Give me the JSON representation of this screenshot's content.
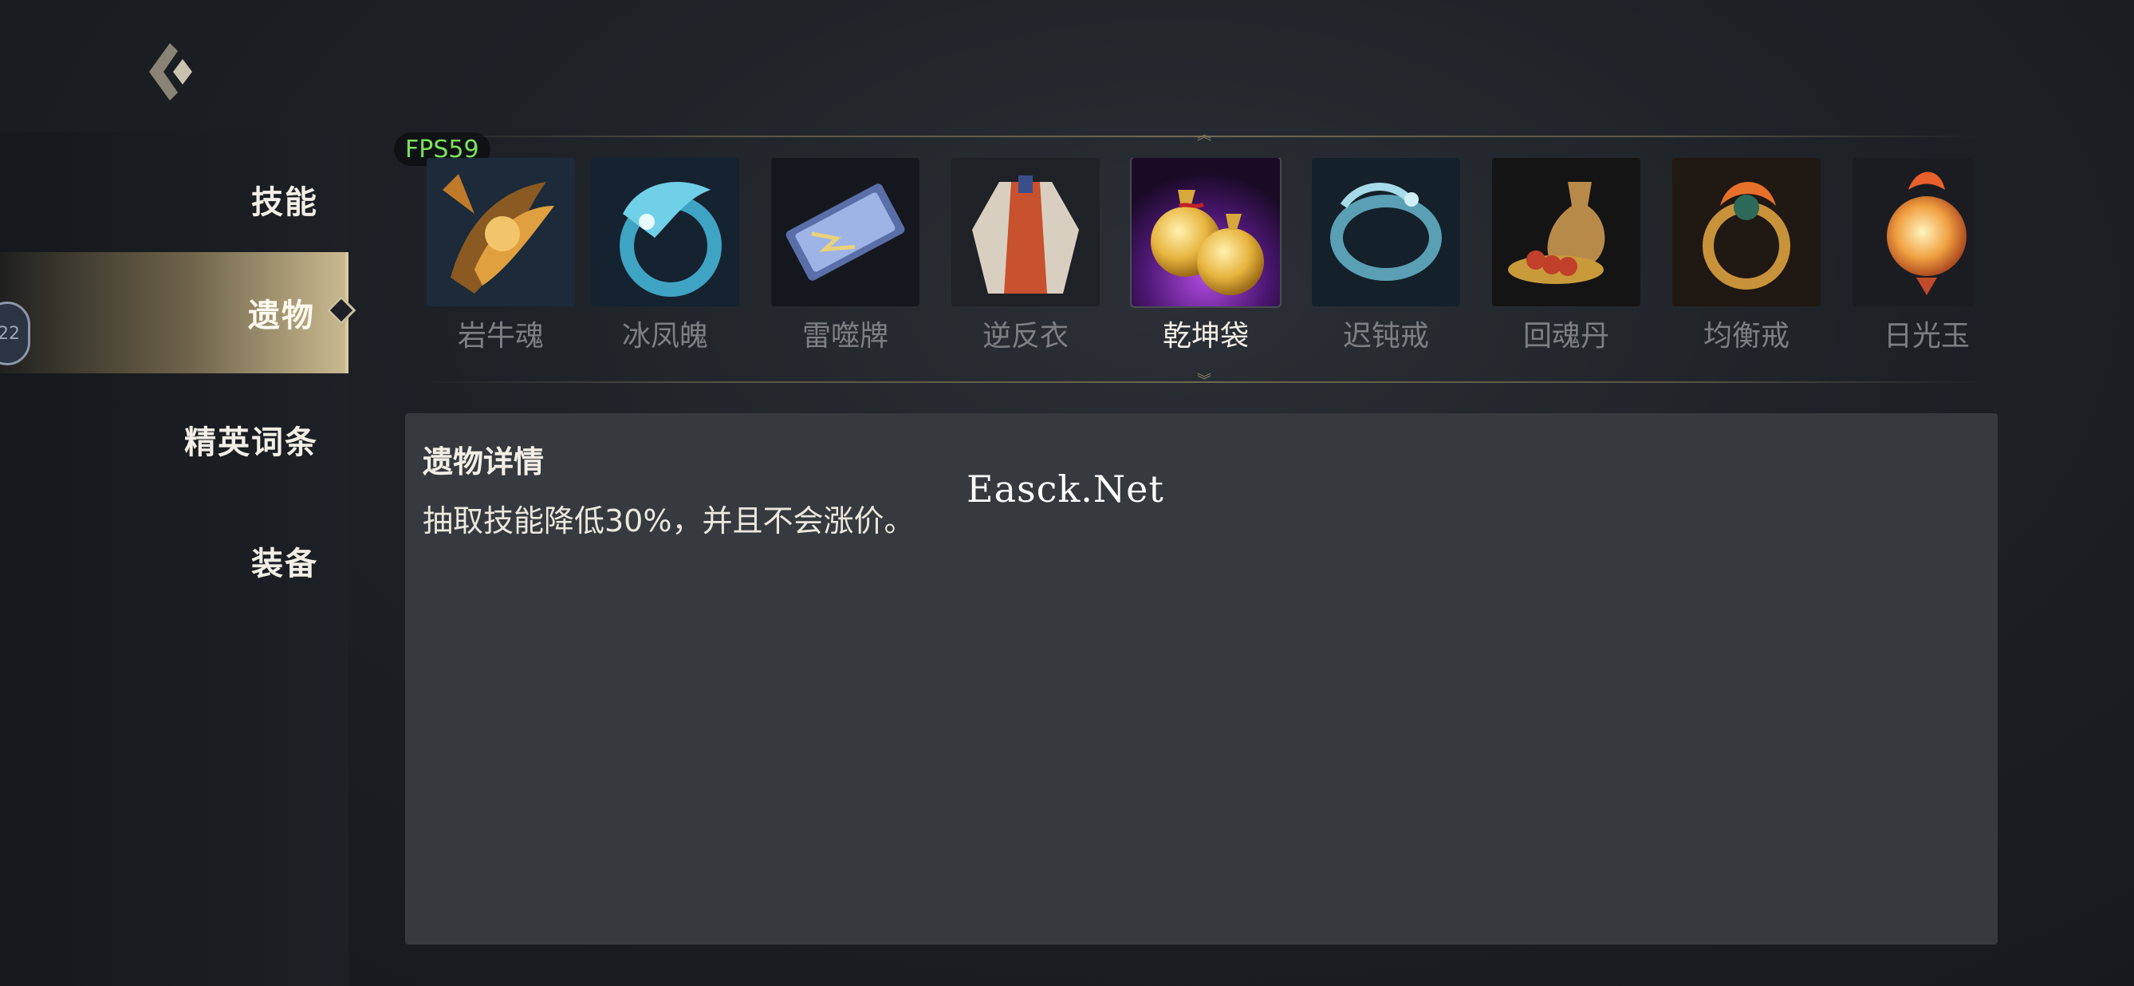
{
  "overlay": {
    "fps": "FPS59",
    "watermark": "Easck.Net"
  },
  "avatar": {
    "text": "22"
  },
  "sidebar": {
    "items": [
      {
        "label": "技能",
        "active": false
      },
      {
        "label": "遗物",
        "active": true
      },
      {
        "label": "精英词条",
        "active": false
      },
      {
        "label": "装备",
        "active": false
      }
    ]
  },
  "relics": [
    {
      "name": "岩牛魂",
      "icon": "bull-spirit-icon"
    },
    {
      "name": "冰凤魄",
      "icon": "ice-phoenix-icon"
    },
    {
      "name": "雷噬牌",
      "icon": "thunder-tablet-icon"
    },
    {
      "name": "逆反衣",
      "icon": "robe-icon"
    },
    {
      "name": "乾坤袋",
      "icon": "gold-pouch-icon",
      "selected": true
    },
    {
      "name": "迟钝戒",
      "icon": "serpent-ring-icon"
    },
    {
      "name": "回魂丹",
      "icon": "elixir-pot-icon"
    },
    {
      "name": "均衡戒",
      "icon": "fire-ring-icon"
    },
    {
      "name": "日光玉",
      "icon": "sun-jade-icon"
    }
  ],
  "detail": {
    "title": "遗物详情",
    "description": "抽取技能降低30%，并且不会涨价。"
  },
  "colors": {
    "accent": "#c9b98f",
    "fps_text": "#7be35d",
    "panel": "#363a3f"
  }
}
